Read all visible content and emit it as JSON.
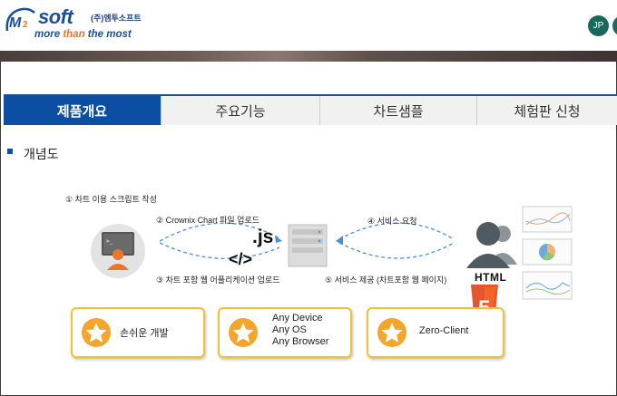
{
  "header": {
    "logo_soft": "soft",
    "logo_company": "(주)엠투소프트",
    "logo_tagline_a": "more ",
    "logo_tagline_b": "than",
    "logo_tagline_c": " the most",
    "avatar_initials": "JP"
  },
  "tabs": [
    {
      "label": "제품개요",
      "active": true
    },
    {
      "label": "주요기능",
      "active": false
    },
    {
      "label": "차트샘플",
      "active": false
    },
    {
      "label": "체험판 신청",
      "active": false
    }
  ],
  "section": {
    "title": "개념도"
  },
  "diagram": {
    "steps": [
      "① 차트 이용 스크립트 작성",
      "② Crownix Chart 파일 업로드",
      "③ 차트 포함 웹 어플리케이션 업로드",
      "④ 서비스 요청",
      "⑤ 서비스 제공 (차트포함 웹 페이지)"
    ],
    "js_mark": ".js",
    "tag_mark": "</>",
    "html_word": "HTML",
    "html_badge_digit": "5"
  },
  "features": [
    {
      "lines": [
        "손쉬운 개발"
      ]
    },
    {
      "lines": [
        "Any Device",
        "Any OS",
        "Any Browser"
      ]
    },
    {
      "lines": [
        "Zero-Client"
      ]
    }
  ],
  "colors": {
    "accent_blue": "#0b4ea2",
    "card_border": "#f4c033",
    "star_fill": "#f4a52b",
    "html5_orange": "#e4572e",
    "avatar_green": "#17695c"
  }
}
